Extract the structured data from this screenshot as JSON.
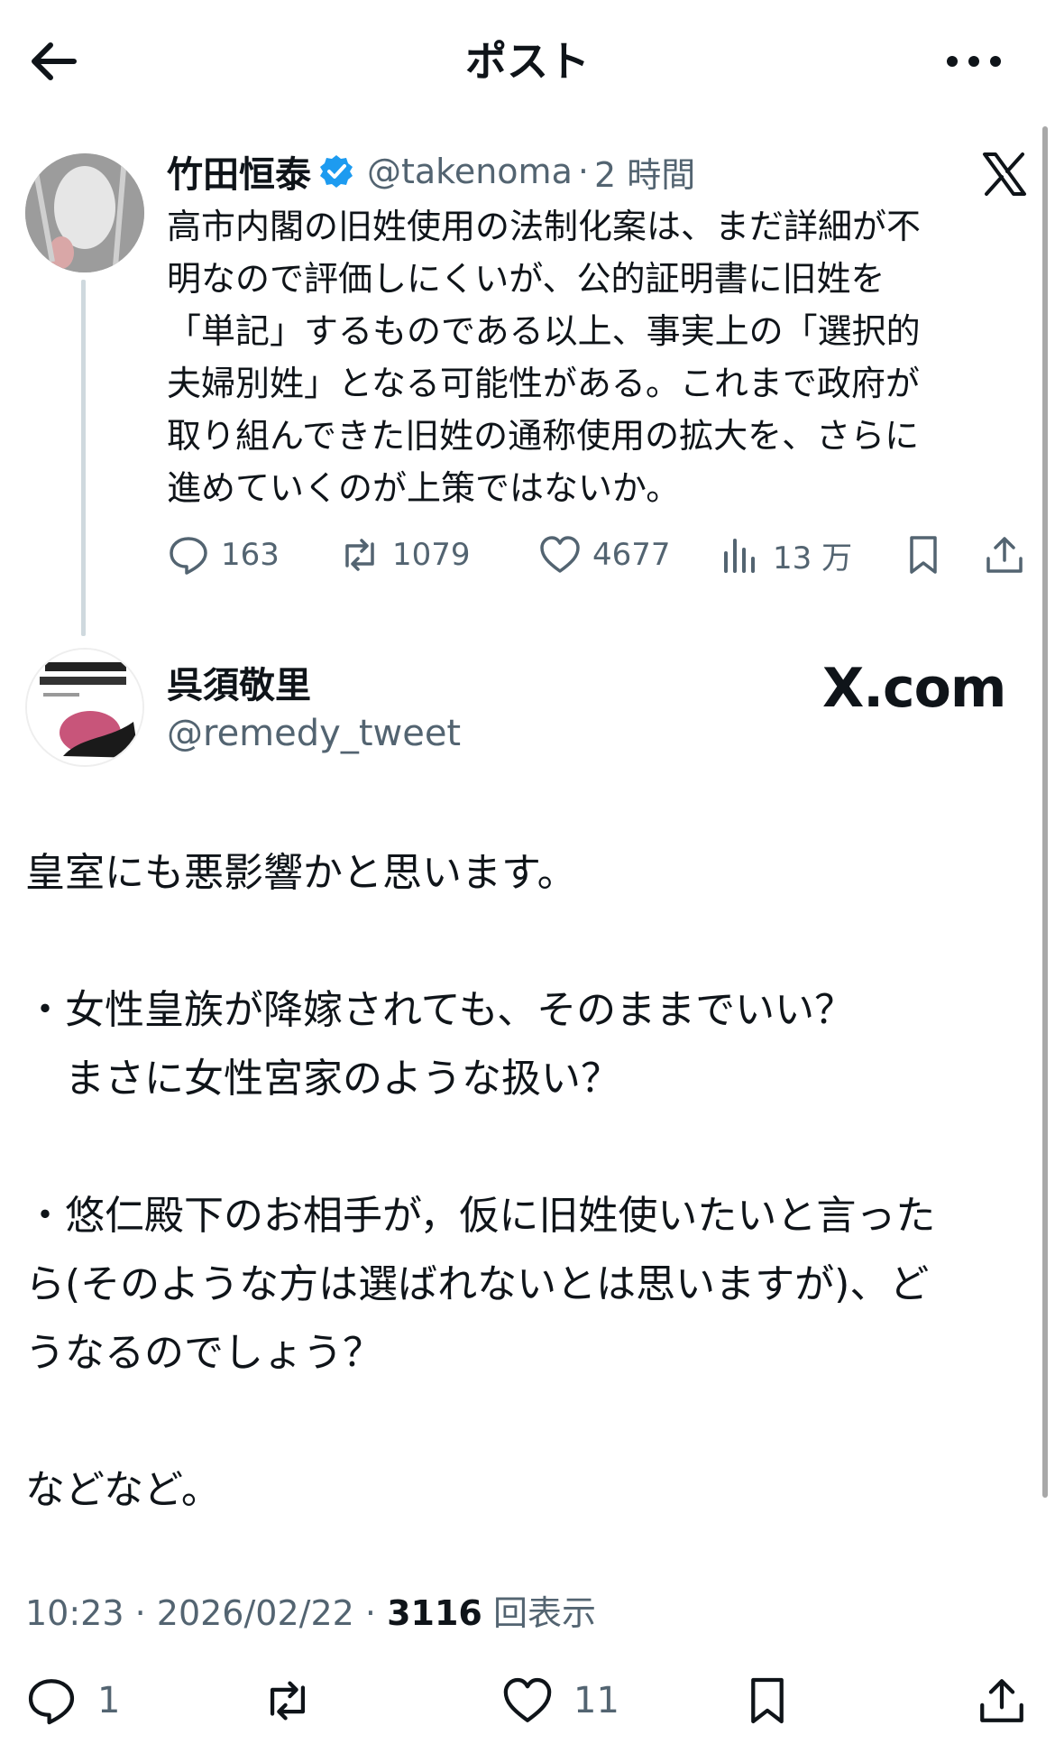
{
  "header": {
    "title": "ポスト",
    "back_icon": "arrow-left-icon",
    "more_icon": "more-horizontal-icon"
  },
  "quoted": {
    "author_name": "竹田恒泰",
    "verified_color": "#1d9bf0",
    "handle": "@takenoma",
    "time": "2 時間",
    "source_icon": "x-logo-icon",
    "text": "高市内閣の旧姓使用の法制化案は、まだ詳細が不\n明なので評価しにくいが、公的証明書に旧姓を\n「単記」するものである以上、事実上の「選択的\n夫婦別姓」となる可能性がある。これまで政府が\n取り組んできた旧姓の通称使用の拡大を、さらに\n進めていくのが上策ではないか。",
    "replies": "163",
    "reposts": "1079",
    "likes": "4677",
    "views": "13 万"
  },
  "post": {
    "author_name": "呉須敬里",
    "handle": "@remedy_tweet",
    "brand": "X.com",
    "text": "皇室にも悪影響かと思います。\n\n・女性皇族が降嫁されても、そのままでいい？\n　まさに女性宮家のような扱い？\n\n・悠仁殿下のお相手が，仮に旧姓使いたいと言った\nら(そのような方は選ばれないとは思いますが)、ど\nうなるのでしょう？\n\nなどなど。",
    "time": "10:23",
    "date": "2026/02/22",
    "view_count": "3116",
    "view_label": "回表示",
    "replies": "1",
    "likes": "11"
  }
}
